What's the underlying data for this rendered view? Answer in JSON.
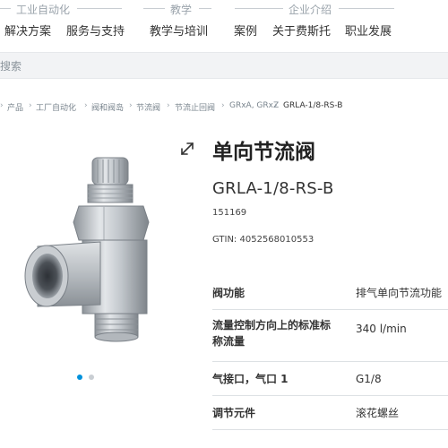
{
  "nav": {
    "groups": [
      "工业自动化",
      "教学",
      "企业介绍"
    ],
    "links": [
      "解决方案",
      "服务与支持",
      "教学与培训",
      "案例",
      "关于费斯托",
      "职业发展"
    ]
  },
  "search": {
    "placeholder": "搜索"
  },
  "breadcrumb": [
    "产品",
    "工厂自动化",
    "阀和阀岛",
    "节流阀",
    "节流止回阀",
    "GRxA, GRxZ",
    "GRLA-1/8-RS-B"
  ],
  "product": {
    "title": "单向节流阀",
    "code": "GRLA-1/8-RS-B",
    "part_number": "151169",
    "gtin": "GTIN: 4052568010553",
    "image_pages": 2,
    "image_active_page": 1
  },
  "specs": [
    {
      "label": "阀功能",
      "value": "排气单向节流功能"
    },
    {
      "label": "流量控制方向上的标准标称流量",
      "value": "340 l/min"
    },
    {
      "label": "气接口，气口 1",
      "value": "G1/8"
    },
    {
      "label": "调节元件",
      "value": "滚花螺丝"
    }
  ],
  "colors": {
    "accent": "#0091dc",
    "text": "#333333",
    "muted": "#9aa3ab",
    "search_bg": "#f2f3f5"
  },
  "icons": {
    "expand": "expand-arrows-icon"
  }
}
